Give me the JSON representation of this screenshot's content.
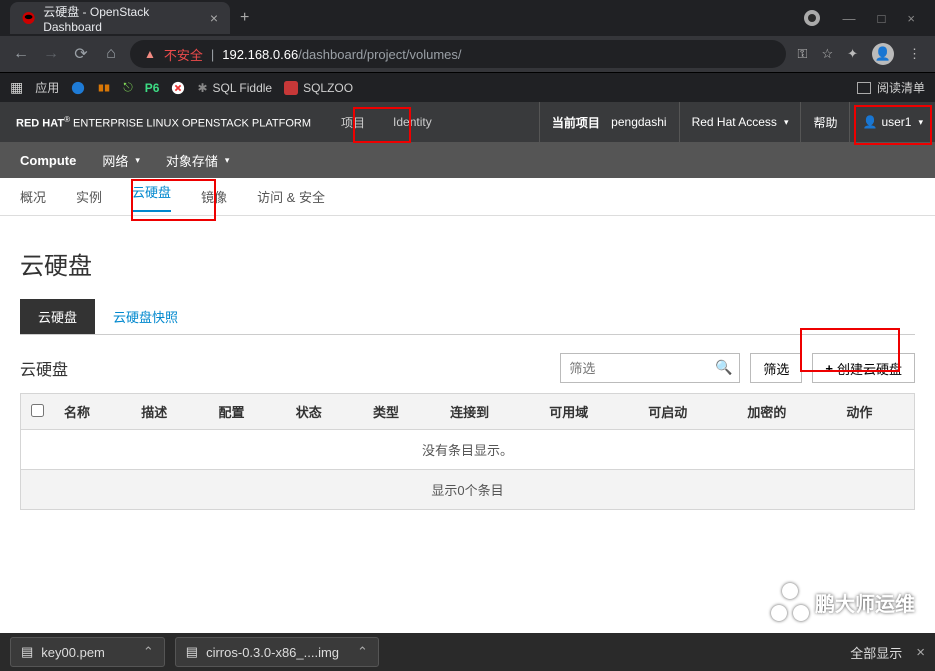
{
  "browser": {
    "tab_title": "云硬盘 - OpenStack Dashboard",
    "url_insecure": "不安全",
    "url_host": "192.168.0.66",
    "url_path": "/dashboard/project/volumes/",
    "bookmarks_label": "应用",
    "bm_sql": "SQL Fiddle",
    "bm_sqlzoo": "SQLZOO",
    "reading_list": "阅读清单",
    "circle_badge": "●"
  },
  "header": {
    "brand_red": "RED HAT",
    "brand_rest": " ENTERPRISE LINUX OPENSTACK PLATFORM",
    "nav1": "项目",
    "nav2": "Identity",
    "cur_proj_label": "当前项目",
    "cur_proj_value": "pengdashi",
    "rha": "Red Hat Access",
    "help": "帮助",
    "user": "user1"
  },
  "subnav": {
    "compute": "Compute",
    "net": "网络",
    "store": "对象存储"
  },
  "sectabs": {
    "overview": "概况",
    "instances": "实例",
    "volumes": "云硬盘",
    "images": "镜像",
    "access": "访问 & 安全"
  },
  "page": {
    "title": "云硬盘",
    "tab_volumes": "云硬盘",
    "tab_snapshots": "云硬盘快照",
    "panel_title": "云硬盘",
    "search_placeholder": "筛选",
    "filter_btn": "筛选",
    "create_btn": "创建云硬盘",
    "cols": {
      "name": "名称",
      "desc": "描述",
      "cfg": "配置",
      "status": "状态",
      "type": "类型",
      "attached": "连接到",
      "zone": "可用域",
      "boot": "可启动",
      "enc": "加密的",
      "actions": "动作"
    },
    "empty": "没有条目显示。",
    "footer": "显示0个条目"
  },
  "downloads": {
    "file1": "key00.pem",
    "file2": "cirros-0.3.0-x86_....img",
    "showall": "全部显示"
  },
  "watermark": "鹏大师运维"
}
